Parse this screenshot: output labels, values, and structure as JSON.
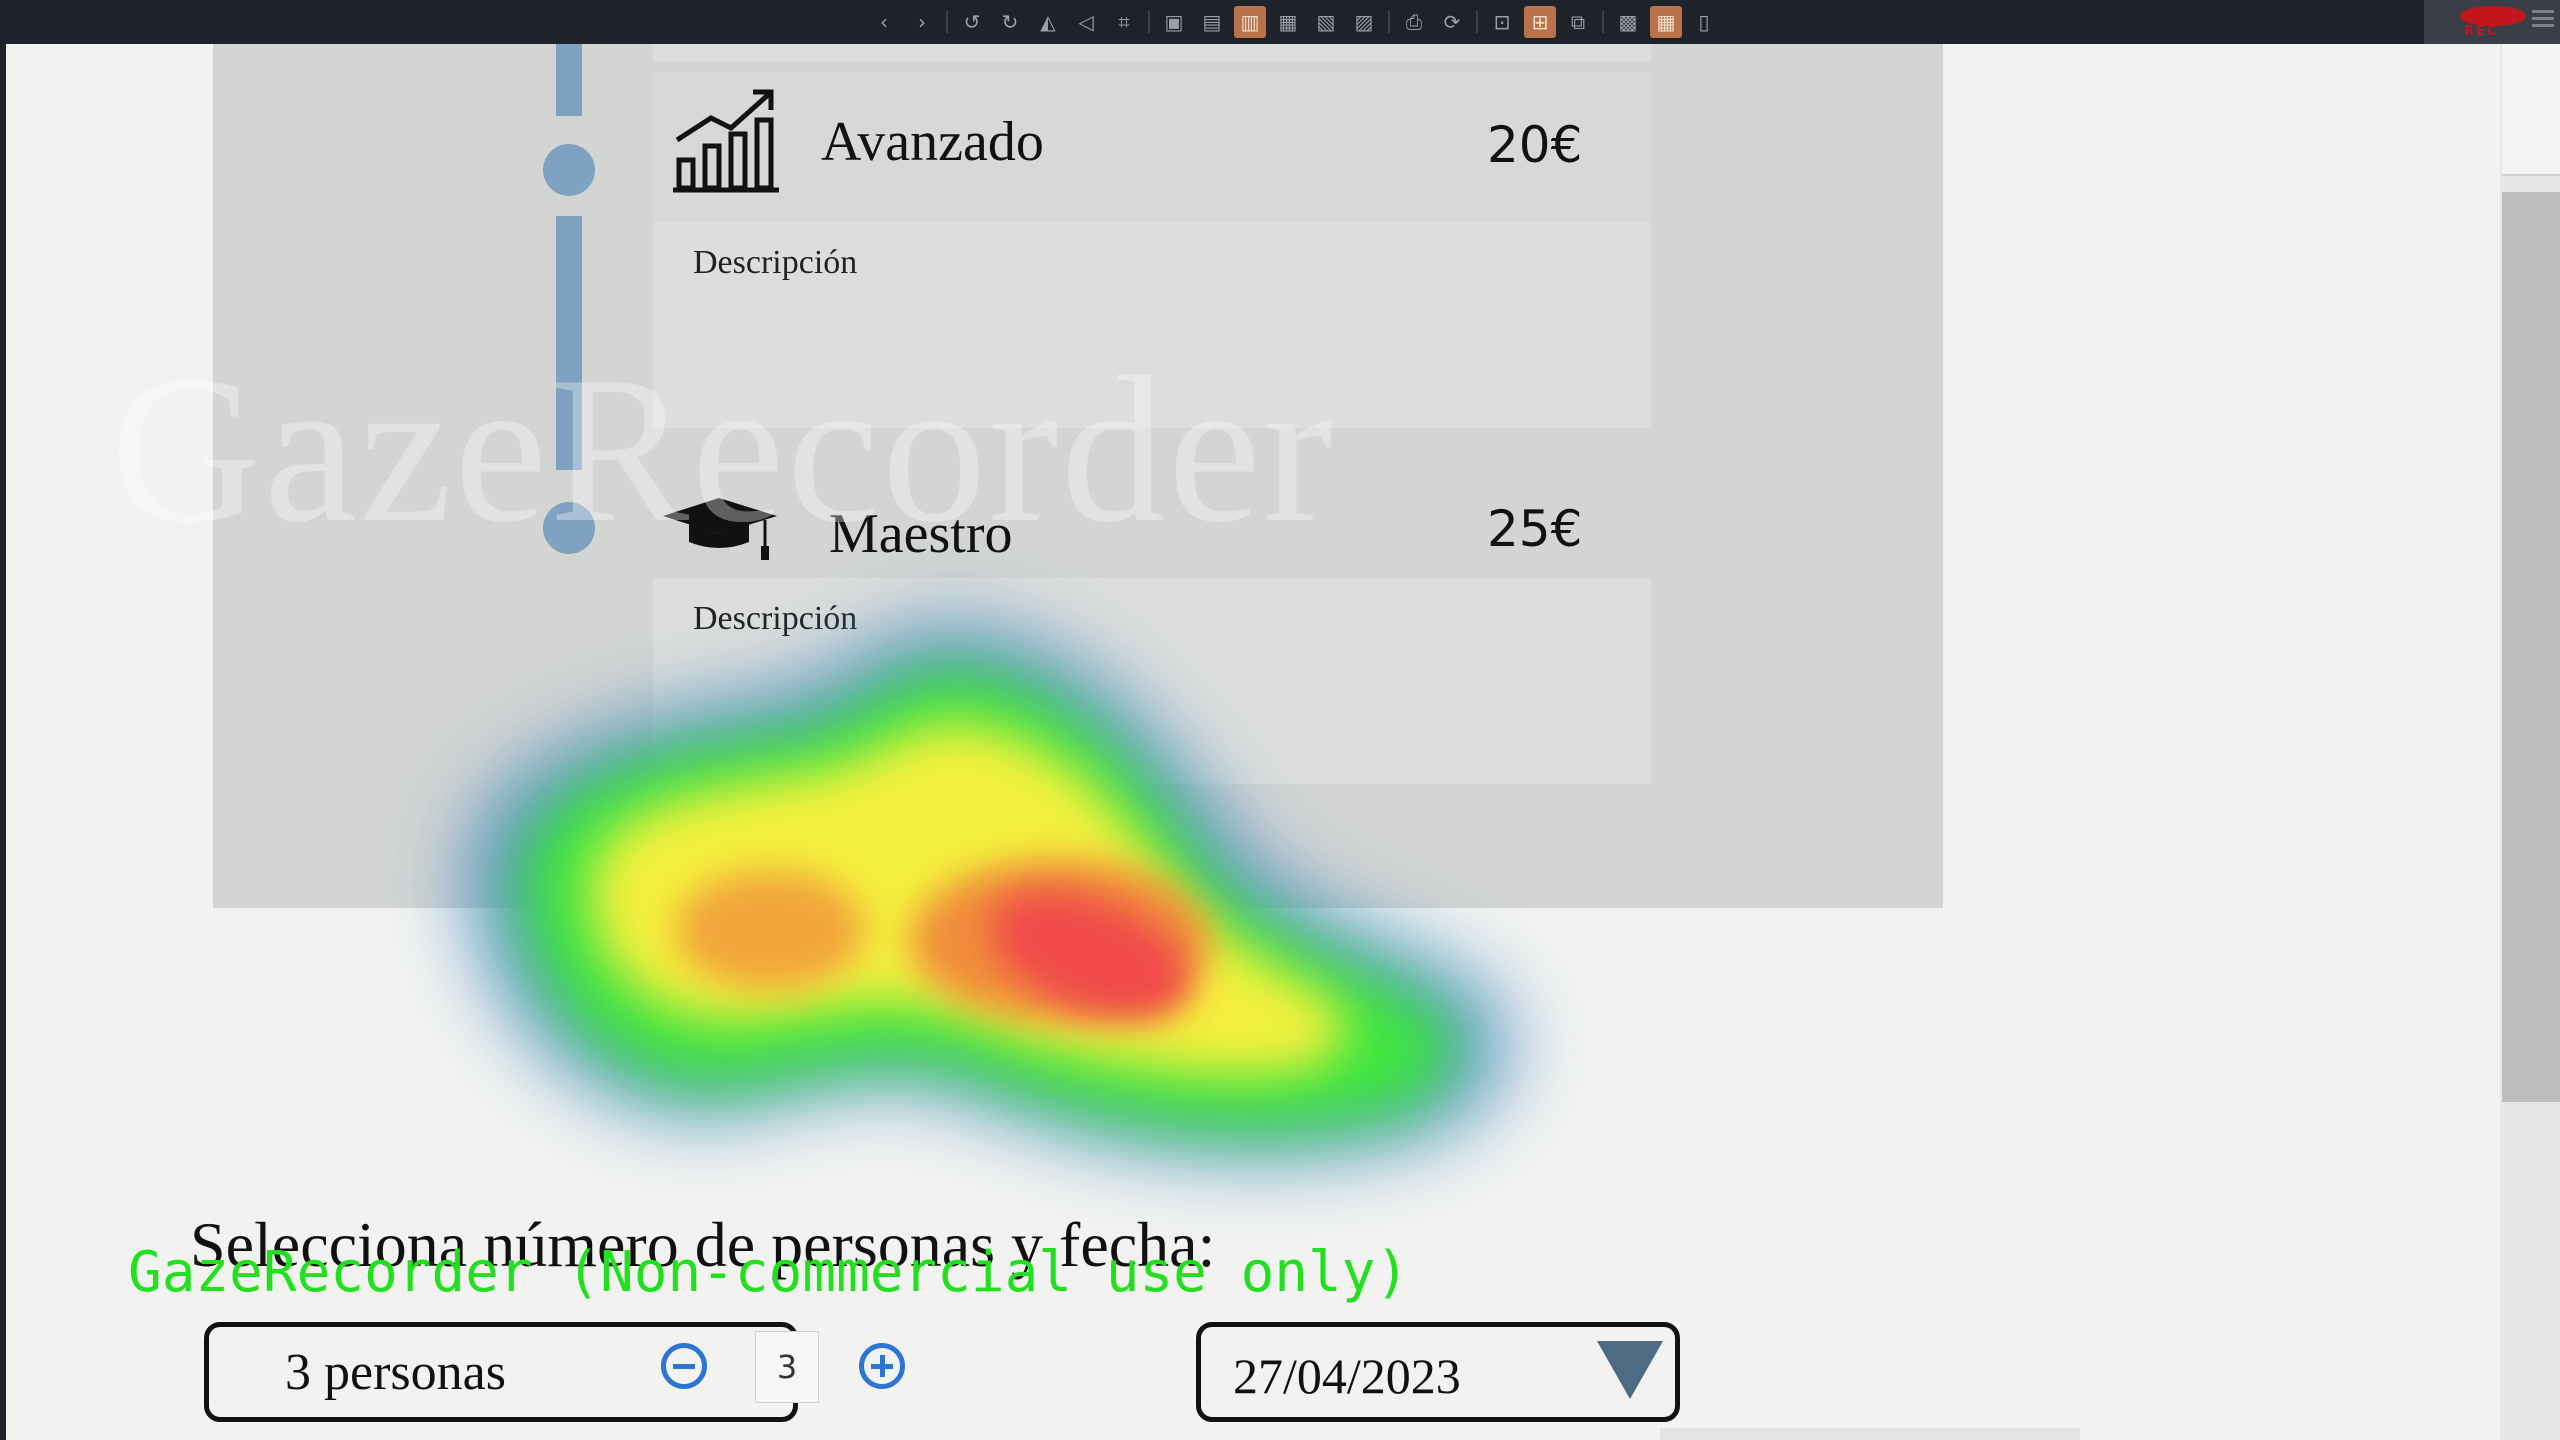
{
  "toolbar": {
    "icons": [
      "chevron-left-icon",
      "chevron-right-icon",
      "undo-icon",
      "redo-icon",
      "flip-icon",
      "perspective-icon",
      "crop-icon",
      "frame-icon",
      "lock-icon",
      "image-icon",
      "layout-icon",
      "grid-icon",
      "filter-icon",
      "print-icon",
      "refresh-icon",
      "resize-icon",
      "expand-icon",
      "compare-icon",
      "picture-icon",
      "tiles-icon",
      "trash-icon"
    ],
    "rec_label": "REC"
  },
  "levels": [
    {
      "name": "Avanzado",
      "price": "20€",
      "description_label": "Descripción",
      "icon": "bar-chart-growth-icon"
    },
    {
      "name": "Maestro",
      "price": "25€",
      "description_label": "Descripción",
      "icon": "graduation-cap-icon"
    }
  ],
  "watermark": "GazeRecorder",
  "selection": {
    "title": "Selecciona número de personas y fecha:",
    "people_label": "3 personas",
    "quantity": "3",
    "date": "27/04/2023"
  },
  "overlay_note": "GazeRecorder (Non-commercial use only)",
  "colors": {
    "timeline": "#7fa2c2",
    "stepper_accent": "#2a76d2",
    "overlay_text": "#22e01e",
    "rec_red": "#c3161c"
  }
}
